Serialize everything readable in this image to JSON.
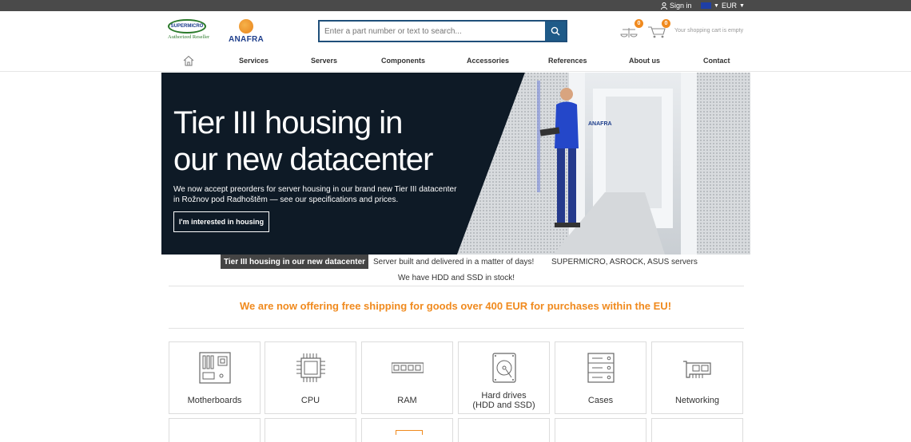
{
  "topbar": {
    "signin_label": "Sign in",
    "currency": "EUR"
  },
  "header": {
    "logo_supermicro_top": "SUPERMICRO",
    "logo_supermicro_bottom": "Authorized Reseller",
    "logo_anafra": "ANAFRA",
    "search_placeholder": "Enter a part number or text to search...",
    "compare_count": "0",
    "cart_count": "0",
    "cart_text": "Your shopping cart is empty"
  },
  "nav": {
    "items": [
      "Services",
      "Servers",
      "Components",
      "Accessories",
      "References",
      "About us",
      "Contact"
    ]
  },
  "hero": {
    "title": "Tier III housing in our new datacenter",
    "description": "We now accept preorders for server housing in our brand new Tier III datacenter in Rožnov pod Radhoštěm — see our specifications and prices.",
    "cta": "I'm interested in housing",
    "photo_logo": "ANAFRA"
  },
  "slider_tabs": {
    "active": "Tier III housing in our new datacenter",
    "items": [
      "Server built and delivered in a matter of days!",
      "SUPERMICRO, ASROCK, ASUS servers",
      "We have HDD and SSD in stock!"
    ]
  },
  "promo": "We are now offering free shipping for goods over 400 EUR for purchases within the EU!",
  "categories": [
    {
      "label": "Motherboards",
      "icon": "motherboard-icon"
    },
    {
      "label": "CPU",
      "icon": "cpu-icon"
    },
    {
      "label": "RAM",
      "icon": "ram-icon"
    },
    {
      "label_line1": "Hard drives",
      "label_line2": "(HDD and SSD)",
      "icon": "hard-drive-icon"
    },
    {
      "label": "Cases",
      "icon": "server-case-icon"
    },
    {
      "label": "Networking",
      "icon": "network-card-icon"
    }
  ],
  "colors": {
    "accent": "#f08a1e",
    "search_border": "#1f4f7a",
    "hero_bg": "#0e1a26",
    "topbar": "#4a4a4a"
  }
}
